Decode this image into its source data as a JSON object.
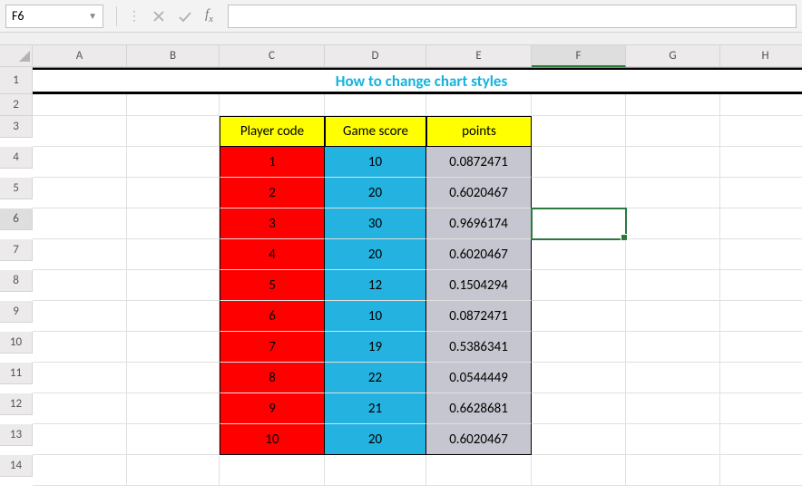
{
  "namebox": "F6",
  "formula": "",
  "title": "How to change chart styles",
  "columns": [
    "A",
    "B",
    "C",
    "D",
    "E",
    "F",
    "G",
    "H"
  ],
  "rows": [
    "1",
    "2",
    "3",
    "4",
    "5",
    "6",
    "7",
    "8",
    "9",
    "10",
    "11",
    "12",
    "13",
    "14"
  ],
  "table": {
    "headers": [
      "Player code",
      "Game score",
      "points"
    ],
    "data": [
      {
        "code": "1",
        "score": "10",
        "points": "0.0872471"
      },
      {
        "code": "2",
        "score": "20",
        "points": "0.6020467"
      },
      {
        "code": "3",
        "score": "30",
        "points": "0.9696174"
      },
      {
        "code": "4",
        "score": "20",
        "points": "0.6020467"
      },
      {
        "code": "5",
        "score": "12",
        "points": "0.1504294"
      },
      {
        "code": "6",
        "score": "10",
        "points": "0.0872471"
      },
      {
        "code": "7",
        "score": "19",
        "points": "0.5386341"
      },
      {
        "code": "8",
        "score": "22",
        "points": "0.0544449"
      },
      {
        "code": "9",
        "score": "21",
        "points": "0.6628681"
      },
      {
        "code": "10",
        "score": "20",
        "points": "0.6020467"
      }
    ]
  },
  "active_cell": "F6"
}
